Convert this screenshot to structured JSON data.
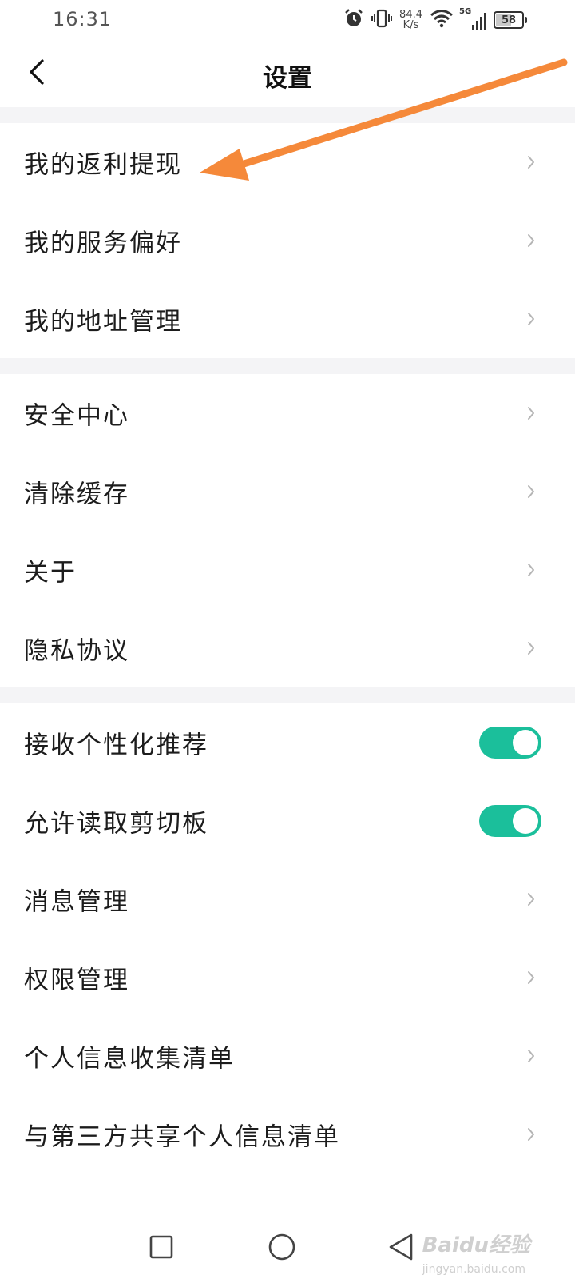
{
  "status_bar": {
    "time": "16:31",
    "net_speed_value": "84.4",
    "net_speed_unit": "K/s",
    "network_type": "5G",
    "battery_level": "58",
    "icons": [
      "alarm-icon",
      "vibrate-icon",
      "wifi-icon",
      "signal-icon",
      "battery-icon"
    ]
  },
  "header": {
    "title": "设置",
    "back_icon": "chevron-left-icon"
  },
  "sections": [
    {
      "items": [
        {
          "label": "我的返利提现",
          "control": "chevron"
        },
        {
          "label": "我的服务偏好",
          "control": "chevron"
        },
        {
          "label": "我的地址管理",
          "control": "chevron"
        }
      ]
    },
    {
      "items": [
        {
          "label": "安全中心",
          "control": "chevron"
        },
        {
          "label": "清除缓存",
          "control": "chevron"
        },
        {
          "label": "关于",
          "control": "chevron"
        },
        {
          "label": "隐私协议",
          "control": "chevron"
        }
      ]
    },
    {
      "items": [
        {
          "label": "接收个性化推荐",
          "control": "toggle",
          "on": true
        },
        {
          "label": "允许读取剪切板",
          "control": "toggle",
          "on": true
        },
        {
          "label": "消息管理",
          "control": "chevron"
        },
        {
          "label": "权限管理",
          "control": "chevron"
        },
        {
          "label": "个人信息收集清单",
          "control": "chevron"
        },
        {
          "label": "与第三方共享个人信息清单",
          "control": "chevron"
        }
      ]
    }
  ],
  "system_nav": {
    "icons": [
      "recent-apps-icon",
      "home-icon",
      "back-icon"
    ]
  },
  "watermark": {
    "text": "Baidu经验",
    "sub": "jingyan.baidu.com"
  },
  "colors": {
    "toggle_on": "#1bbf9b",
    "section_gap": "#f4f4f6",
    "chevron": "#b5b5b5",
    "annotation_arrow": "#f5893a"
  }
}
